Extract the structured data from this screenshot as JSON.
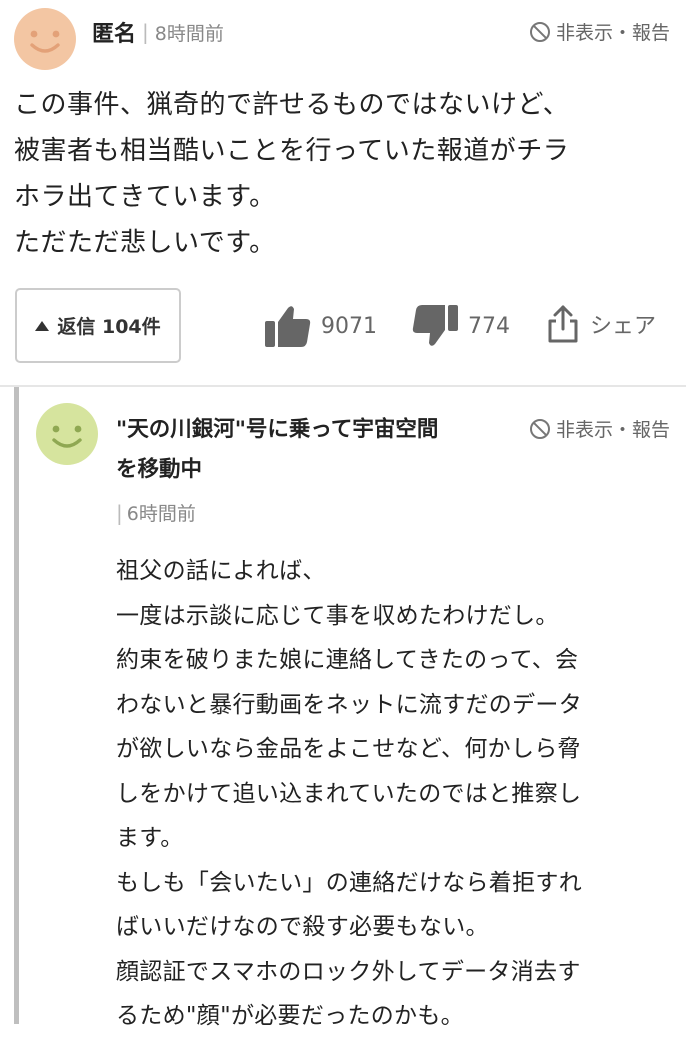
{
  "comment": {
    "author": "匿名",
    "separator": "|",
    "time": "8時間前",
    "hide_report": "非表示・報告",
    "body_lines": [
      "この事件、猟奇的で許せるものではないけど、",
      "被害者も相当酷いことを行っていた報道がチラ",
      "ホラ出てきています。",
      "ただただ悲しいです。"
    ],
    "reply_button": "返信 104件",
    "likes": "9071",
    "dislikes": "774",
    "share": "シェア"
  },
  "reply": {
    "author_line1": "\"天の川銀河\"号に乗って宇宙空間",
    "author_line2": "を移動中",
    "separator": "|",
    "time": "6時間前",
    "hide_report": "非表示・報告",
    "body_lines": [
      "祖父の話によれば、",
      "一度は示談に応じて事を収めたわけだし。",
      "約束を破りまた娘に連絡してきたのって、会",
      "わないと暴行動画をネットに流すだのデータ",
      "が欲しいなら金品をよこせなど、何かしら脅",
      "しをかけて追い込まれていたのではと推察し",
      "ます。",
      "もしも「会いたい」の連絡だけなら着拒すれ",
      "ばいいだけなので殺す必要もない。",
      "顔認証でスマホのロック外してデータ消去す",
      "るため\"顔\"が必要だったのかも。"
    ]
  },
  "colors": {
    "avatar_orange": "#f3c6a3",
    "avatar_orange_face": "#e3a178",
    "avatar_green": "#d6e49e",
    "avatar_green_face": "#8fa852"
  }
}
